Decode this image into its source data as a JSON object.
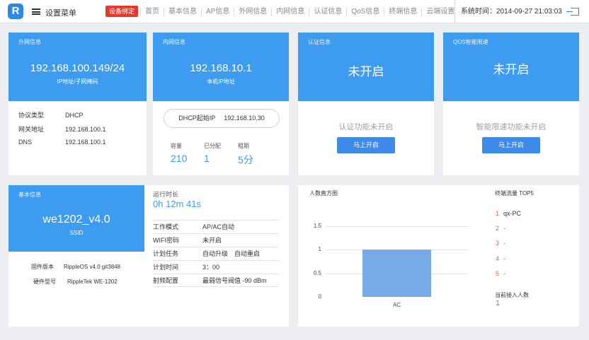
{
  "header": {
    "logo": "R",
    "menu_label": "设置菜单",
    "bind_button": "设备绑定",
    "nav": [
      "首页",
      "基本信息",
      "AP信息",
      "外网信息",
      "内网信息",
      "认证信息",
      "QoS信息",
      "终端信息",
      "云端设置"
    ],
    "system_time": "系统时间：2014-09-27 21:03:03"
  },
  "wan": {
    "title": "外网信息",
    "ip": "192.168.100.149/24",
    "ip_caption": "IP地址/子网掩码",
    "rows": [
      {
        "label": "协议类型",
        "value": "DHCP"
      },
      {
        "label": "网关地址",
        "value": "192.168.100.1"
      },
      {
        "label": "DNS",
        "value": "192.168.100.1"
      }
    ]
  },
  "lan": {
    "title": "内网信息",
    "ip": "192.168.10.1",
    "ip_caption": "本机IP地址",
    "dhcp_label": "DHCP起始IP",
    "dhcp_value": "192.168.10.30",
    "stats": [
      {
        "label": "容量",
        "value": "210"
      },
      {
        "label": "已分配",
        "value": "1"
      },
      {
        "label": "租期",
        "value": "5分"
      }
    ]
  },
  "auth": {
    "title": "认证信息",
    "status": "未开启",
    "message": "认证功能未开启",
    "button": "马上开启"
  },
  "qos": {
    "title": "QOS智能限速",
    "status": "未开启",
    "message": "智能限速功能未开启",
    "button": "马上开启"
  },
  "basic": {
    "title": "基本信息",
    "ssid_value": "we1202_v4.0",
    "ssid_caption": "SSID",
    "firmware_label": "固件版本",
    "firmware_value": "RippleOS v4.0 git3848",
    "hardware_label": "硬件型号",
    "hardware_value": "RippleTek WE-1202",
    "runtime_label": "运行时长",
    "runtime_value": "0h 12m 41s",
    "rows": [
      {
        "label": "工作模式",
        "value": "AP/AC自动"
      },
      {
        "label": "WIFI密码",
        "value": "未开启"
      },
      {
        "label": "计划任务",
        "value": "自动升级　自动重启"
      },
      {
        "label": "计划时间",
        "value": "3：00"
      },
      {
        "label": "射频配置",
        "value": "最弱信号阀值 -90 dBm"
      }
    ]
  },
  "chart_data": {
    "type": "bar",
    "title": "人数直方图",
    "categories": [
      "AC"
    ],
    "values": [
      1
    ],
    "ylim": [
      0,
      1.5
    ],
    "yticks": [
      "0",
      "0.5",
      "1",
      "1.5"
    ],
    "grid": true,
    "bar_color": "#77aae8"
  },
  "top5": {
    "title": "终端流量 TOP5",
    "items": [
      {
        "rank": "1",
        "name": "qx-PC"
      },
      {
        "rank": "2",
        "name": "-"
      },
      {
        "rank": "3",
        "name": "-"
      },
      {
        "rank": "4",
        "name": "-"
      },
      {
        "rank": "5",
        "name": "-"
      }
    ],
    "current_label": "当前接入人数",
    "current_value": "1"
  }
}
